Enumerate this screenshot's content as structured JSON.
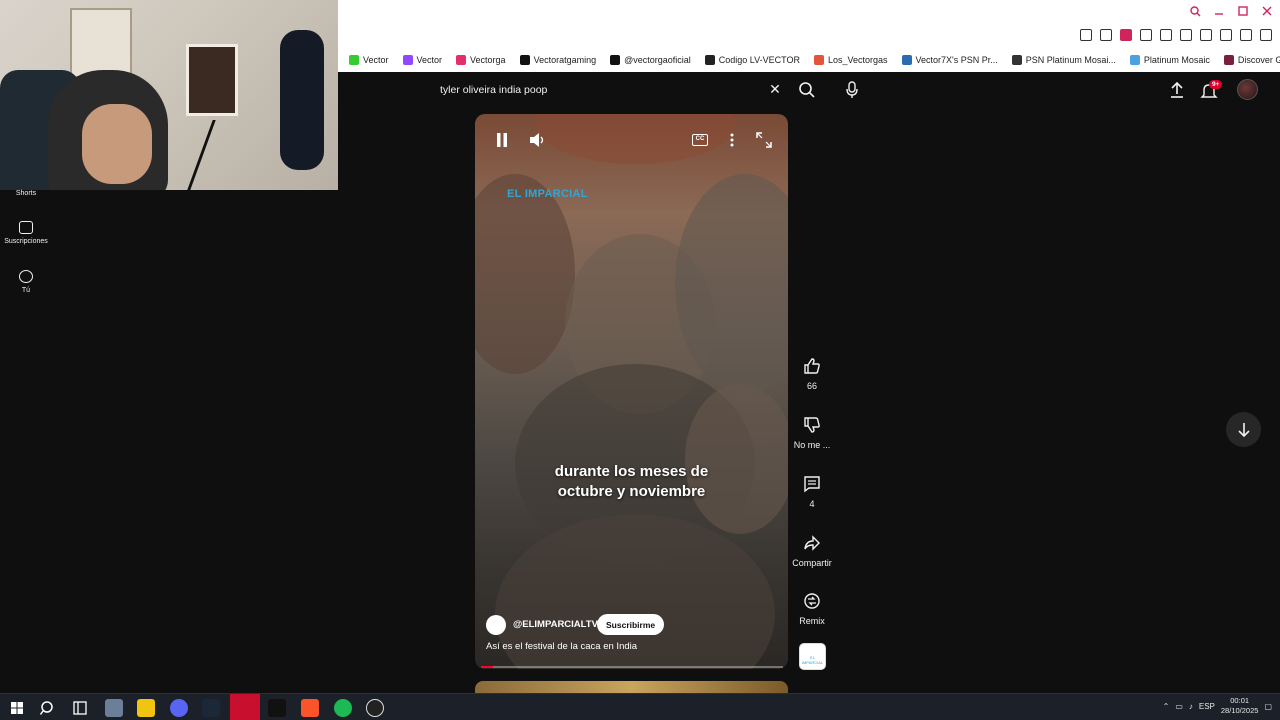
{
  "browser": {
    "bookmarks": [
      {
        "label": "Vector",
        "color": "#33cc33"
      },
      {
        "label": "Vector",
        "color": "#9146ff"
      },
      {
        "label": "Vectorga",
        "color": "#e1306c"
      },
      {
        "label": "Vectoratgaming",
        "color": "#111111"
      },
      {
        "label": "@vectorgaoficial",
        "color": "#111111"
      },
      {
        "label": "Codigo LV-VECTOR",
        "color": "#222222"
      },
      {
        "label": "Los_Vectorgas",
        "color": "#e2553b"
      },
      {
        "label": "Vector7X's PSN Pr...",
        "color": "#2b6cb0"
      },
      {
        "label": "PSN Platinum Mosai...",
        "color": "#333333"
      },
      {
        "label": "Platinum Mosaic",
        "color": "#4aa3df"
      },
      {
        "label": "Discover Games -...",
        "color": "#7a1f3d"
      }
    ]
  },
  "youtube": {
    "sidebar": [
      {
        "label": "Shorts"
      },
      {
        "label": "Suscripciones"
      },
      {
        "label": "Tú"
      }
    ],
    "search": {
      "query": "tyler oliveira india poop"
    },
    "notifications_badge": "9+",
    "short": {
      "watermark": "EL IMPARCIAL",
      "subtitle_line1": "durante los meses de",
      "subtitle_line2": "octubre y noviembre",
      "channel": "@ELIMPARCIALTV",
      "subscribe_label": "Suscribirme",
      "title": "Así es el festival de la caca en India",
      "progress": 0.04
    },
    "actions": {
      "likes": "66",
      "dislike_label": "No me ...",
      "comments": "4",
      "share_label": "Compartir",
      "remix_label": "Remix"
    }
  },
  "taskbar": {
    "language": "ESP",
    "time": "00:01",
    "date": "28/10/2025"
  },
  "colors": {
    "accent": "#ff0033",
    "background": "#0f0f0f",
    "taskbar": "#1c2029"
  }
}
